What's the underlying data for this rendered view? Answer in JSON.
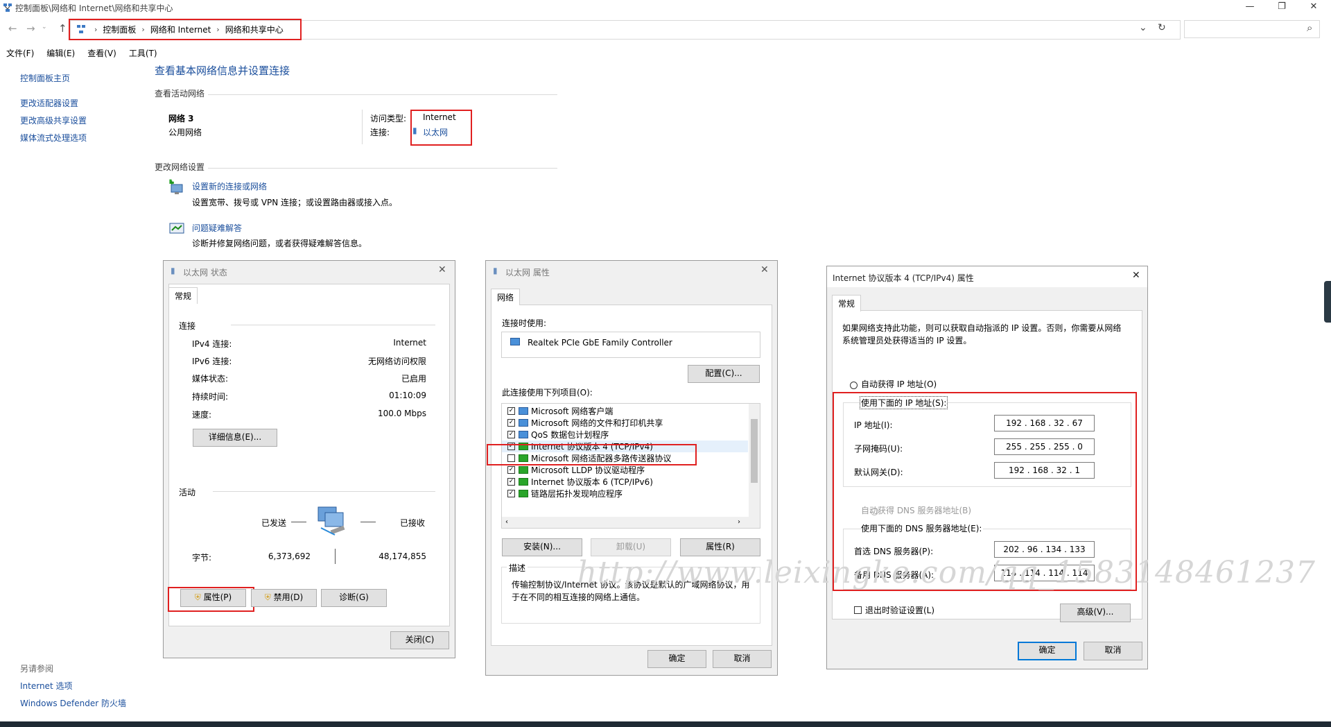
{
  "window": {
    "title": "控制面板\\网络和 Internet\\网络和共享中心",
    "minimize": "—",
    "maximize": "❐",
    "close": "✕"
  },
  "address": {
    "crumbs": [
      "控制面板",
      "网络和 Internet",
      "网络和共享中心"
    ],
    "refresh": "↻",
    "dropdown": "⌄",
    "search_icon": "⌕"
  },
  "menu": [
    "文件(F)",
    "编辑(E)",
    "查看(V)",
    "工具(T)"
  ],
  "sidebar": {
    "home": "控制面板主页",
    "links": [
      "更改适配器设置",
      "更改高级共享设置",
      "媒体流式处理选项"
    ],
    "see_also": "另请参阅",
    "see_also_links": [
      "Internet 选项",
      "Windows Defender 防火墙"
    ]
  },
  "main": {
    "title": "查看基本网络信息并设置连接",
    "active_networks": "查看活动网络",
    "network_name": "网络 3",
    "network_type": "公用网络",
    "access_type_label": "访问类型:",
    "access_type_value": "Internet",
    "connection_label": "连接:",
    "connection_value": "以太网",
    "change_settings": "更改网络设置",
    "setup_link": "设置新的连接或网络",
    "setup_desc": "设置宽带、拨号或 VPN 连接；或设置路由器或接入点。",
    "troubleshoot_link": "问题疑难解答",
    "troubleshoot_desc": "诊断并修复网络问题，或者获得疑难解答信息。"
  },
  "status_dialog": {
    "title": "以太网 状态",
    "tab": "常规",
    "connection_group": "连接",
    "rows": [
      {
        "label": "IPv4 连接:",
        "value": "Internet"
      },
      {
        "label": "IPv6 连接:",
        "value": "无网络访问权限"
      },
      {
        "label": "媒体状态:",
        "value": "已启用"
      },
      {
        "label": "持续时间:",
        "value": "01:10:09"
      },
      {
        "label": "速度:",
        "value": "100.0 Mbps"
      }
    ],
    "details_button": "详细信息(E)...",
    "activity_group": "活动",
    "sent_label": "已发送",
    "received_label": "已接收",
    "bytes_label": "字节:",
    "bytes_sent": "6,373,692",
    "bytes_received": "48,174,855",
    "properties_button": "属性(P)",
    "disable_button": "禁用(D)",
    "diagnose_button": "诊断(G)",
    "close_button": "关闭(C)"
  },
  "props_dialog": {
    "title": "以太网 属性",
    "tab": "网络",
    "connect_using": "连接时使用:",
    "adapter": "Realtek PCIe GbE Family Controller",
    "configure_button": "配置(C)...",
    "items_label": "此连接使用下列项目(O):",
    "items": [
      {
        "label": "Microsoft 网络客户端",
        "checked": true
      },
      {
        "label": "Microsoft 网络的文件和打印机共享",
        "checked": true
      },
      {
        "label": "QoS 数据包计划程序",
        "checked": true
      },
      {
        "label": "Internet 协议版本 4 (TCP/IPv4)",
        "checked": true
      },
      {
        "label": "Microsoft 网络适配器多路传送器协议",
        "checked": false
      },
      {
        "label": "Microsoft LLDP 协议驱动程序",
        "checked": true
      },
      {
        "label": "Internet 协议版本 6 (TCP/IPv6)",
        "checked": true
      },
      {
        "label": "链路层拓扑发现响应程序",
        "checked": true
      }
    ],
    "install_button": "安装(N)...",
    "uninstall_button": "卸载(U)",
    "properties_button": "属性(R)",
    "description_label": "描述",
    "description": "传输控制协议/Internet 协议。该协议是默认的广域网络协议，用于在不同的相互连接的网络上通信。",
    "ok_button": "确定",
    "cancel_button": "取消"
  },
  "ipv4_dialog": {
    "title": "Internet 协议版本 4 (TCP/IPv4) 属性",
    "tab": "常规",
    "intro": "如果网络支持此功能，则可以获取自动指派的 IP 设置。否则，你需要从网络系统管理员处获得适当的 IP 设置。",
    "auto_ip": "自动获得 IP 地址(O)",
    "manual_ip": "使用下面的 IP 地址(S):",
    "ip_label": "IP 地址(I):",
    "ip_value": "192 . 168 . 32 . 67",
    "mask_label": "子网掩码(U):",
    "mask_value": "255 . 255 . 255 . 0",
    "gateway_label": "默认网关(D):",
    "gateway_value": "192 . 168 . 32 . 1",
    "auto_dns": "自动获得 DNS 服务器地址(B)",
    "manual_dns": "使用下面的 DNS 服务器地址(E):",
    "dns1_label": "首选 DNS 服务器(P):",
    "dns1_value": "202 . 96 . 134 . 133",
    "dns2_label": "备用 DNS 服务器(A):",
    "dns2_value": "114 . 114 . 114 . 114",
    "validate_label": "退出时验证设置(L)",
    "advanced_button": "高级(V)...",
    "ok_button": "确定",
    "cancel_button": "取消"
  },
  "watermark": "http://www.leixingke.com/qq_1583148461237",
  "colors": {
    "link": "#1a4e9c",
    "highlight": "#e02020",
    "accent": "#0078d7"
  }
}
